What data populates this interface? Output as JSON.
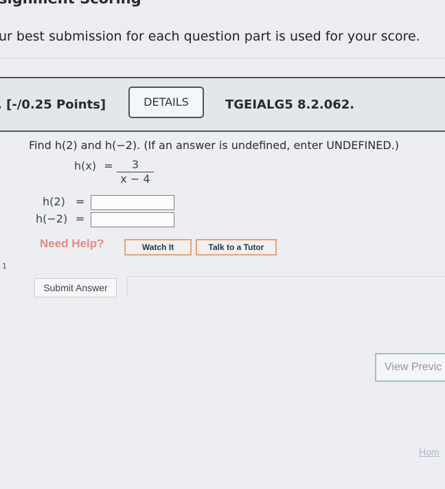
{
  "page": {
    "heading": "signment Scoring",
    "intro": "ur best submission for each question part is used for your score."
  },
  "question": {
    "points": ". [-/0.25 Points]",
    "details_label": "DETAILS",
    "code": "TGEIALG5 8.2.062.",
    "prompt": "Find h(2) and h(−2). (If an answer is undefined, enter UNDEFINED.)",
    "function": {
      "lhs": "h(x)",
      "equals": "=",
      "numerator": "3",
      "denominator": "x − 4"
    },
    "answers": [
      {
        "label": "h(2)",
        "equals": "=",
        "value": ""
      },
      {
        "label": "h(−2)",
        "equals": "=",
        "value": ""
      }
    ]
  },
  "help": {
    "need_help": "Need Help?",
    "watch_it": "Watch It",
    "talk_to_tutor": "Talk to a Tutor"
  },
  "actions": {
    "submit": "Submit Answer",
    "view_previous": "View Previc",
    "home": "Hom"
  },
  "margin_mark": "1",
  "colors": {
    "need_help": "#e38b85",
    "help_button_border": "#e7a27a",
    "view_previous_border": "#8fc7c3",
    "header_rule": "#4a4d52"
  }
}
